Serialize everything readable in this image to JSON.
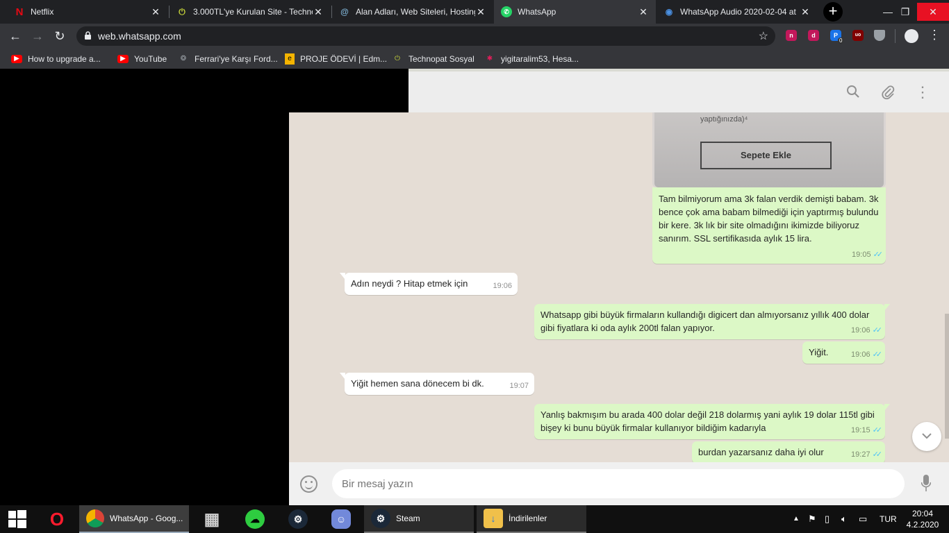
{
  "browser": {
    "tabs": [
      {
        "title": "Netflix",
        "icon": "netflix-icon"
      },
      {
        "title": "3.000TL'ye Kurulan Site - Techno",
        "icon": "technopat-icon"
      },
      {
        "title": "Alan Adları, Web Siteleri, Hosting",
        "icon": "hosting-icon"
      },
      {
        "title": "WhatsApp",
        "icon": "whatsapp-icon",
        "active": true
      },
      {
        "title": "WhatsApp Audio 2020-02-04 at",
        "icon": "edge-icon"
      }
    ],
    "url": "web.whatsapp.com",
    "extensions": [
      {
        "label": "n",
        "color": "#c2185b"
      },
      {
        "label": "d",
        "color": "#c2185b"
      },
      {
        "label": "P",
        "color": "#1a73e8",
        "badge": "0"
      },
      {
        "label": "uo",
        "color": "#800000"
      },
      {
        "label": "",
        "color": "#9aa0a6"
      }
    ]
  },
  "bookmarks": [
    {
      "label": "How to upgrade a...",
      "icon": "youtube-icon"
    },
    {
      "label": "YouTube",
      "icon": "youtube-icon"
    },
    {
      "label": "Ferrari'ye Karşı Ford...",
      "icon": "movie-icon"
    },
    {
      "label": "PROJE ÖDEVİ | Edm...",
      "icon": "edmodo-icon"
    },
    {
      "label": "Technopat Sosyal",
      "icon": "technopat-icon"
    },
    {
      "label": "yigitaralim53, Hesa...",
      "icon": "slack-icon"
    }
  ],
  "chat": {
    "image_message": {
      "caption_top": "yaptığınızda)⁴",
      "button_text": "Sepete Ekle"
    },
    "messages": [
      {
        "dir": "out",
        "text": "Tam bilmiyorum ama 3k falan verdik demişti babam. 3k bence çok ama babam bilmediği için yaptırmış bulundu bir kere. 3k lık bir site olmadığını ikimizde biliyoruz sanırım. SSL sertifikasıda aylık 15 lira.",
        "time": "19:05",
        "read": true
      },
      {
        "dir": "in",
        "text": "Adın neydi ? Hitap etmek için",
        "time": "19:06"
      },
      {
        "dir": "out",
        "text": "Whatsapp gibi büyük firmaların kullandığı digicert dan almıyorsanız yıllık 400 dolar gibi fiyatlara ki oda aylık 200tl falan yapıyor.",
        "time": "19:06",
        "read": true
      },
      {
        "dir": "out",
        "text": "Yiğit.",
        "time": "19:06",
        "read": true
      },
      {
        "dir": "in",
        "text": "Yiğit hemen sana dönecem bi dk.",
        "time": "19:07"
      },
      {
        "dir": "out",
        "text": "Yanlış bakmışım bu arada 400 dolar değil 218 dolarmış yani aylık 19 dolar 115tl gibi bişey ki bunu büyük firmalar kullanıyor bildiğim kadarıyla",
        "time": "19:15",
        "read": true
      },
      {
        "dir": "out",
        "text": "burdan yazarsanız daha iyi olur",
        "time": "19:27",
        "read": true
      }
    ],
    "ticks": "✓✓"
  },
  "compose": {
    "placeholder": "Bir mesaj yazın"
  },
  "taskbar": {
    "items": [
      {
        "label": "",
        "icon": "opera-icon"
      },
      {
        "label": "WhatsApp - Goog...",
        "icon": "chrome-icon"
      },
      {
        "label": "",
        "icon": "building-icon"
      },
      {
        "label": "",
        "icon": "cloud-icon"
      },
      {
        "label": "",
        "icon": "steam-icon"
      },
      {
        "label": "",
        "icon": "discord-icon"
      },
      {
        "label": "Steam",
        "icon": "steam-icon"
      },
      {
        "label": "İndirilenler",
        "icon": "folder-icon"
      }
    ],
    "language": "TUR",
    "time": "20:04",
    "date": "4.2.2020"
  }
}
